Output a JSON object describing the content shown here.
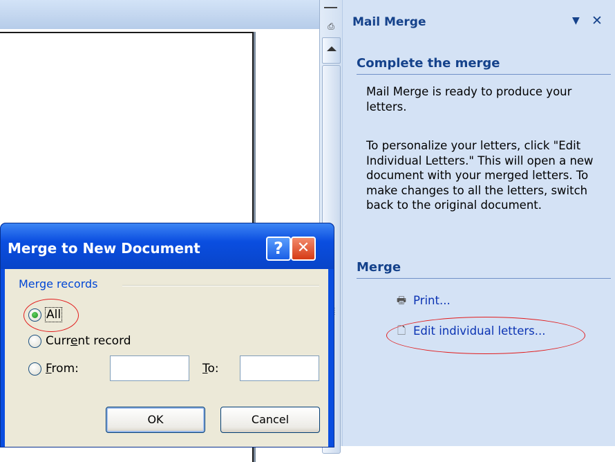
{
  "task_pane": {
    "title": "Mail Merge",
    "dropdown_icon": "▼",
    "close_icon": "✕",
    "section_complete": "Complete the merge",
    "para1": "Mail Merge is ready to produce your letters.",
    "para2": "To personalize your letters, click \"Edit Individual Letters.\" This will open a new document with your merged letters. To make changes to all the letters, switch back to the original document.",
    "section_merge": "Merge",
    "print_label": "Print...",
    "edit_label": "Edit individual letters..."
  },
  "dialog": {
    "title": "Merge to New Document",
    "help_label": "?",
    "close_label": "✕",
    "group_label": "Merge records",
    "opt_all": "All",
    "opt_current_pre": "Curr",
    "opt_current_u": "e",
    "opt_current_post": "nt record",
    "opt_from_u": "F",
    "opt_from_post": "rom:",
    "to_u": "T",
    "to_post": "o:",
    "from_value": "",
    "to_value": "",
    "ok_label": "OK",
    "cancel_label": "Cancel",
    "selected": "All"
  },
  "colors": {
    "accent": "#15428b",
    "link": "#0b33b3",
    "highlight": "#e21c1c"
  }
}
